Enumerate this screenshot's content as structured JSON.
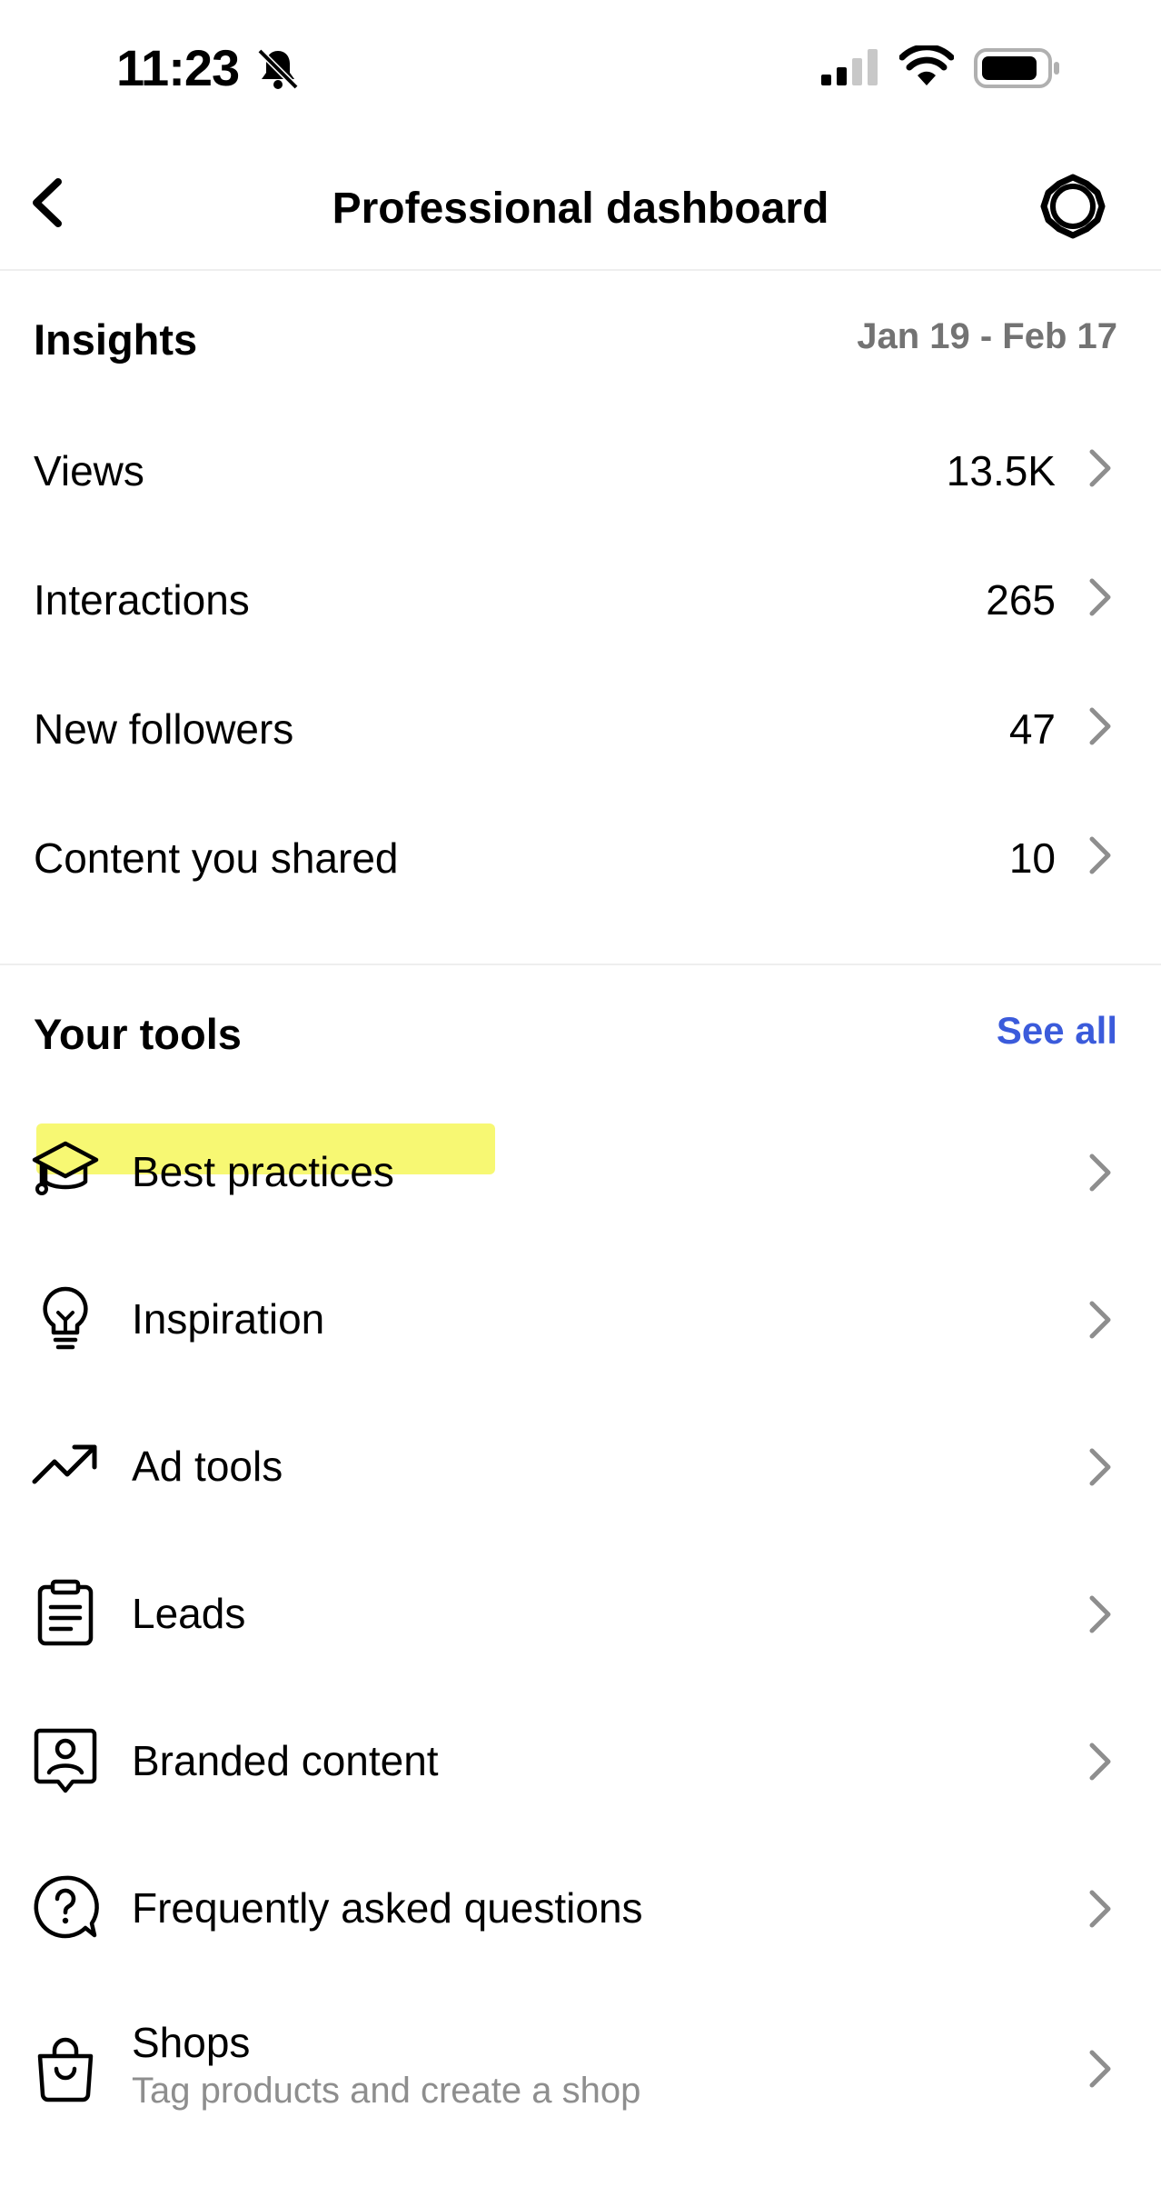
{
  "status_bar": {
    "time": "11:23"
  },
  "header": {
    "title": "Professional dashboard"
  },
  "insights": {
    "title": "Insights",
    "date_range": "Jan 19 - Feb 17",
    "metrics": [
      {
        "label": "Views",
        "value": "13.5K"
      },
      {
        "label": "Interactions",
        "value": "265"
      },
      {
        "label": "New followers",
        "value": "47"
      },
      {
        "label": "Content you shared",
        "value": "10"
      }
    ]
  },
  "tools": {
    "title": "Your tools",
    "see_all": "See all",
    "items": [
      {
        "label": "Best practices",
        "icon": "graduation-cap-icon",
        "highlighted": true
      },
      {
        "label": "Inspiration",
        "icon": "lightbulb-icon"
      },
      {
        "label": "Ad tools",
        "icon": "trending-up-icon"
      },
      {
        "label": "Leads",
        "icon": "clipboard-icon"
      },
      {
        "label": "Branded content",
        "icon": "branded-content-icon"
      },
      {
        "label": "Frequently asked questions",
        "icon": "question-bubble-icon"
      },
      {
        "label": "Shops",
        "subtitle": "Tag products and create a shop",
        "icon": "shopping-bag-icon"
      }
    ]
  },
  "colors": {
    "accent": "#3b5bdb",
    "secondary_text": "#737373",
    "highlight": "#f6f75a"
  }
}
